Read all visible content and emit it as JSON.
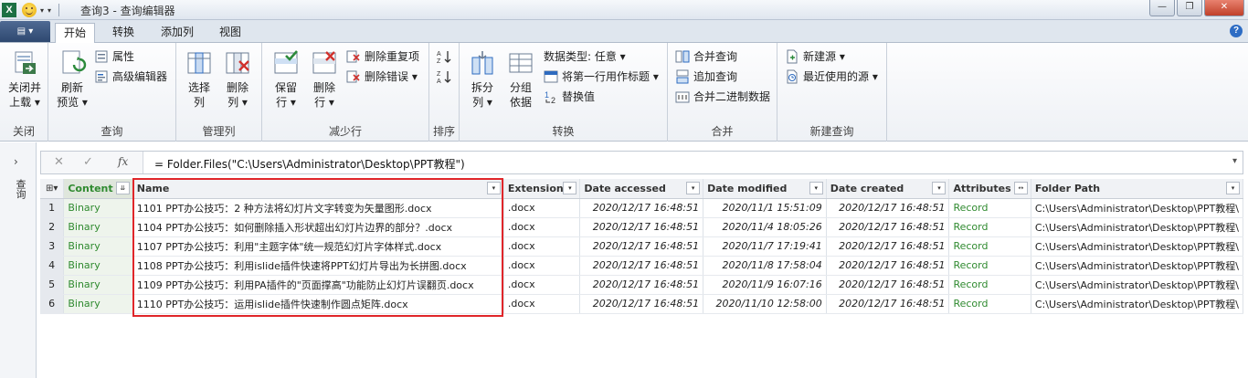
{
  "window": {
    "app_icon": "excel-x",
    "title": "查询3 - 查询编辑器",
    "minimize": "—",
    "restore": "❐",
    "close": "✕"
  },
  "tabs": {
    "file": "▤ ▾",
    "items": [
      "开始",
      "转换",
      "添加列",
      "视图"
    ],
    "active": "开始"
  },
  "ribbon": {
    "close_group": {
      "label": "关闭",
      "close_load": "关闭并",
      "close_load_2": "上载 ▾"
    },
    "query_group": {
      "label": "查询",
      "refresh": "刷新",
      "refresh_2": "预览 ▾",
      "properties": "属性",
      "advanced_editor": "高级编辑器"
    },
    "manage_cols_group": {
      "label": "管理列",
      "select_cols": "选择",
      "select_cols_2": "列",
      "remove_cols": "删除",
      "remove_cols_2": "列 ▾"
    },
    "reduce_rows_group": {
      "label": "减少行",
      "keep_rows": "保留",
      "keep_rows_2": "行 ▾",
      "remove_rows": "删除",
      "remove_rows_2": "行 ▾",
      "remove_duplicates": "删除重复项",
      "remove_errors": "删除错误 ▾"
    },
    "sort_group": {
      "label": "排序"
    },
    "transform_group": {
      "label": "转换",
      "split_col": "拆分",
      "split_col_2": "列 ▾",
      "group_by": "分组",
      "group_by_2": "依据",
      "data_type": "数据类型: 任意 ▾",
      "use_first_row": "将第一行用作标题 ▾",
      "replace_values": "替换值"
    },
    "combine_group": {
      "label": "合并",
      "merge_queries": "合并查询",
      "append_queries": "追加查询",
      "combine_binaries": "合并二进制数据"
    },
    "new_query_group": {
      "label": "新建查询",
      "new_source": "新建源 ▾",
      "recent_sources": "最近使用的源 ▾"
    }
  },
  "nav": {
    "label": "查询",
    "chevron": "›"
  },
  "formula": {
    "cancel": "✕",
    "confirm": "✓",
    "fx": "fx",
    "text": "= Folder.Files(\"C:\\Users\\Administrator\\Desktop\\PPT教程\")",
    "expand": "▾"
  },
  "table": {
    "columns": [
      "Content",
      "Name",
      "Extension",
      "Date accessed",
      "Date modified",
      "Date created",
      "Attributes",
      "Folder Path"
    ],
    "rows": [
      {
        "n": "1",
        "content": "Binary",
        "name": "1101    PPT办公技巧：2 种方法将幻灯片文字转变为矢量图形.docx",
        "ext": ".docx",
        "accessed": "2020/12/17 16:48:51",
        "modified": "2020/11/1 15:51:09",
        "created": "2020/12/17 16:48:51",
        "attr": "Record",
        "path": "C:\\Users\\Administrator\\Desktop\\PPT教程\\"
      },
      {
        "n": "2",
        "content": "Binary",
        "name": "1104    PPT办公技巧：如何删除插入形状超出幻灯片边界的部分？.docx",
        "ext": ".docx",
        "accessed": "2020/12/17 16:48:51",
        "modified": "2020/11/4 18:05:26",
        "created": "2020/12/17 16:48:51",
        "attr": "Record",
        "path": "C:\\Users\\Administrator\\Desktop\\PPT教程\\"
      },
      {
        "n": "3",
        "content": "Binary",
        "name": "1107    PPT办公技巧：利用\"主题字体\"统一规范幻灯片字体样式.docx",
        "ext": ".docx",
        "accessed": "2020/12/17 16:48:51",
        "modified": "2020/11/7 17:19:41",
        "created": "2020/12/17 16:48:51",
        "attr": "Record",
        "path": "C:\\Users\\Administrator\\Desktop\\PPT教程\\"
      },
      {
        "n": "4",
        "content": "Binary",
        "name": "1108    PPT办公技巧：利用islide插件快速将PPT幻灯片导出为长拼图.docx",
        "ext": ".docx",
        "accessed": "2020/12/17 16:48:51",
        "modified": "2020/11/8 17:58:04",
        "created": "2020/12/17 16:48:51",
        "attr": "Record",
        "path": "C:\\Users\\Administrator\\Desktop\\PPT教程\\"
      },
      {
        "n": "5",
        "content": "Binary",
        "name": "1109    PPT办公技巧：利用PA插件的\"页面撑高\"功能防止幻灯片误翻页.docx",
        "ext": ".docx",
        "accessed": "2020/12/17 16:48:51",
        "modified": "2020/11/9 16:07:16",
        "created": "2020/12/17 16:48:51",
        "attr": "Record",
        "path": "C:\\Users\\Administrator\\Desktop\\PPT教程\\"
      },
      {
        "n": "6",
        "content": "Binary",
        "name": "1110    PPT办公技巧：运用islide插件快速制作圆点矩阵.docx",
        "ext": ".docx",
        "accessed": "2020/12/17 16:48:51",
        "modified": "2020/11/10 12:58:00",
        "created": "2020/12/17 16:48:51",
        "attr": "Record",
        "path": "C:\\Users\\Administrator\\Desktop\\PPT教程\\"
      }
    ]
  }
}
